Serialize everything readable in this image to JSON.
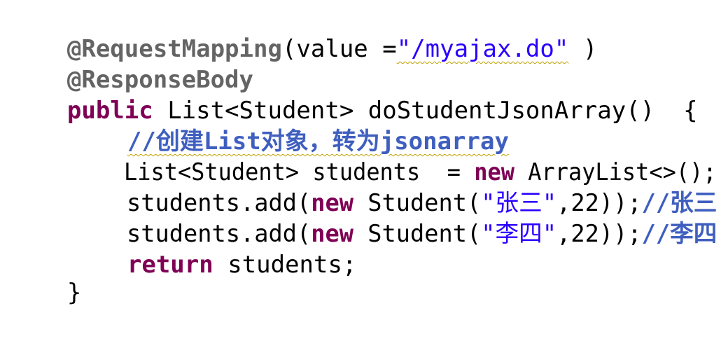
{
  "editor": {
    "lines": [
      {
        "annotation": "@RequestMapping",
        "paren_open": "(value =",
        "string": "\"/myajax.do\"",
        "paren_close": " )"
      },
      {
        "annotation": "@ResponseBody"
      },
      {
        "kw": "public",
        "rest": " List<Student> doStudentJsonArray()  {"
      },
      {
        "comment": "//创建List对象，转为jsonarray"
      },
      {
        "pre": "List<Student> students  = ",
        "kw": "new",
        "post": " ArrayList<>();"
      },
      {
        "pre": "students.add(",
        "kw": "new",
        "mid": " Student(",
        "string": "\"张三\"",
        "num": ",22));",
        "comment": "//张三"
      },
      {
        "pre": "students.add(",
        "kw": "new",
        "mid": " Student(",
        "string": "\"李四\"",
        "num": ",22));",
        "comment": "//李四"
      },
      {
        "kw": "return",
        "rest": " students;"
      },
      {
        "brace": "}"
      }
    ]
  },
  "colors": {
    "annotation": "#646464",
    "keyword": "#7f0055",
    "string": "#2a00ff",
    "comment": "#3f5fbf"
  }
}
